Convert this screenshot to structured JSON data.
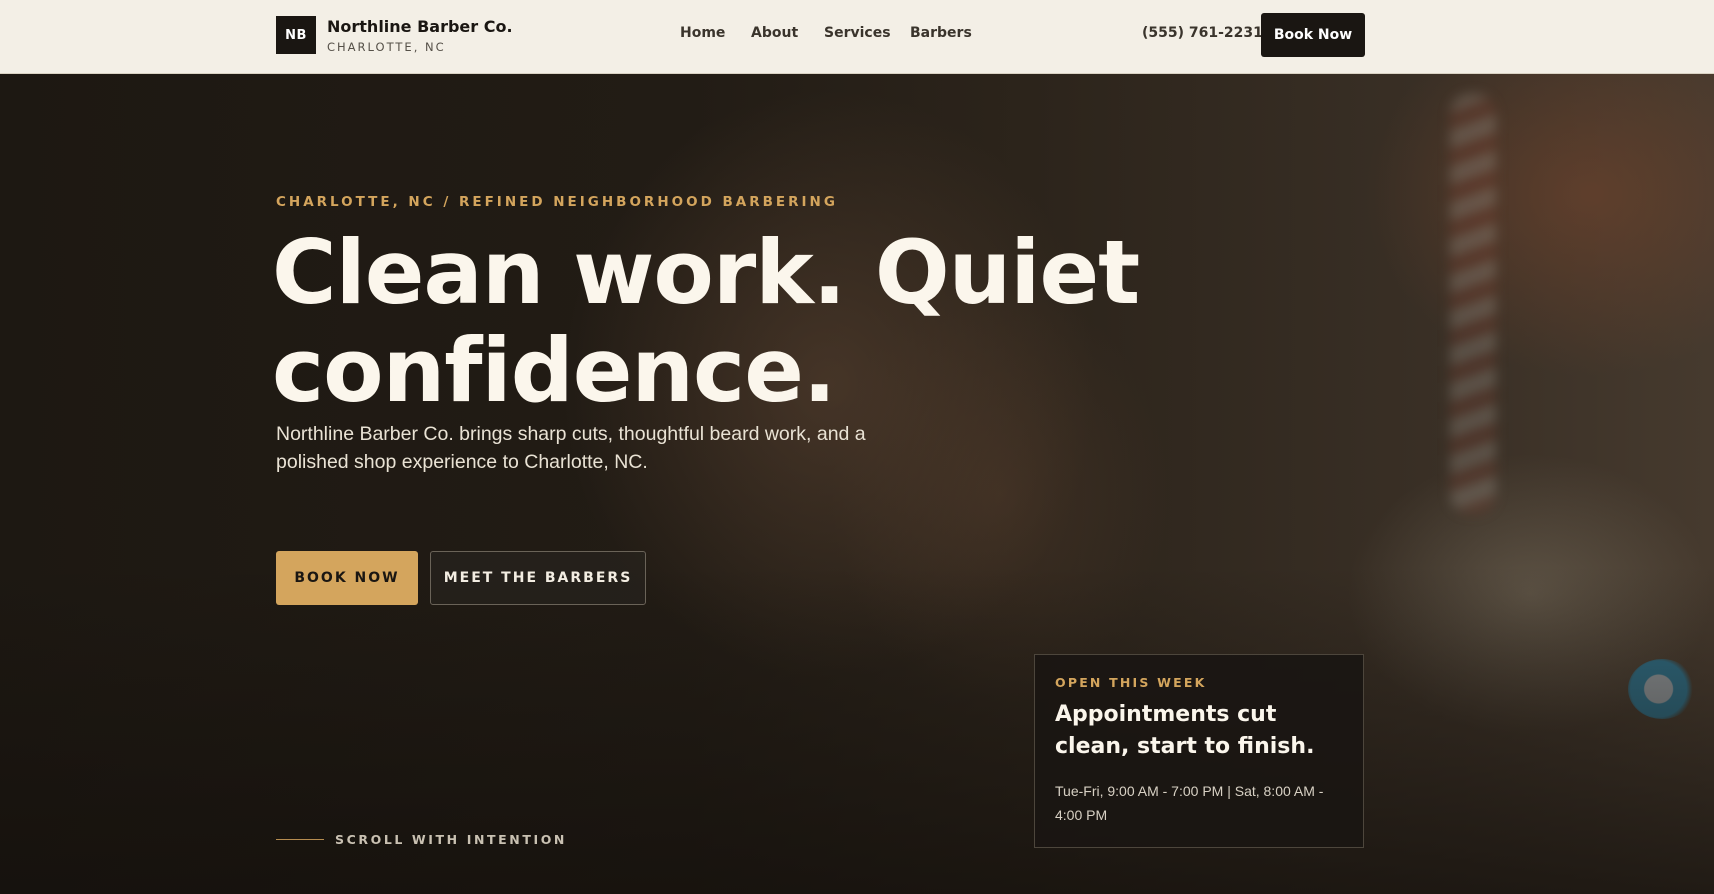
{
  "header": {
    "logo_initials": "NB",
    "brand_name": "Northline Barber Co.",
    "brand_location": "CHARLOTTE, NC",
    "nav": [
      {
        "label": "Home"
      },
      {
        "label": "About"
      },
      {
        "label": "Services"
      },
      {
        "label": "Barbers"
      }
    ],
    "phone": "(555) 761-2231",
    "cta_label": "Book Now"
  },
  "hero": {
    "eyebrow": "CHARLOTTE, NC / REFINED NEIGHBORHOOD BARBERING",
    "headline": "Clean work. Quiet confidence.",
    "subtext": "Northline Barber Co. brings sharp cuts, thoughtful beard work, and a polished shop experience to Charlotte, NC.",
    "primary_button": "BOOK NOW",
    "secondary_button": "MEET THE BARBERS",
    "scroll_hint": "SCROLL WITH INTENTION"
  },
  "hours_card": {
    "eyebrow": "OPEN THIS WEEK",
    "title": "Appointments cut clean, start to finish.",
    "hours": "Tue-Fri, 9:00 AM - 7:00 PM | Sat, 8:00 AM - 4:00 PM"
  },
  "colors": {
    "accent": "#d4a55d",
    "dark": "#1a1612",
    "header_bg": "#f3efe6",
    "headline": "#fbf6ec"
  }
}
